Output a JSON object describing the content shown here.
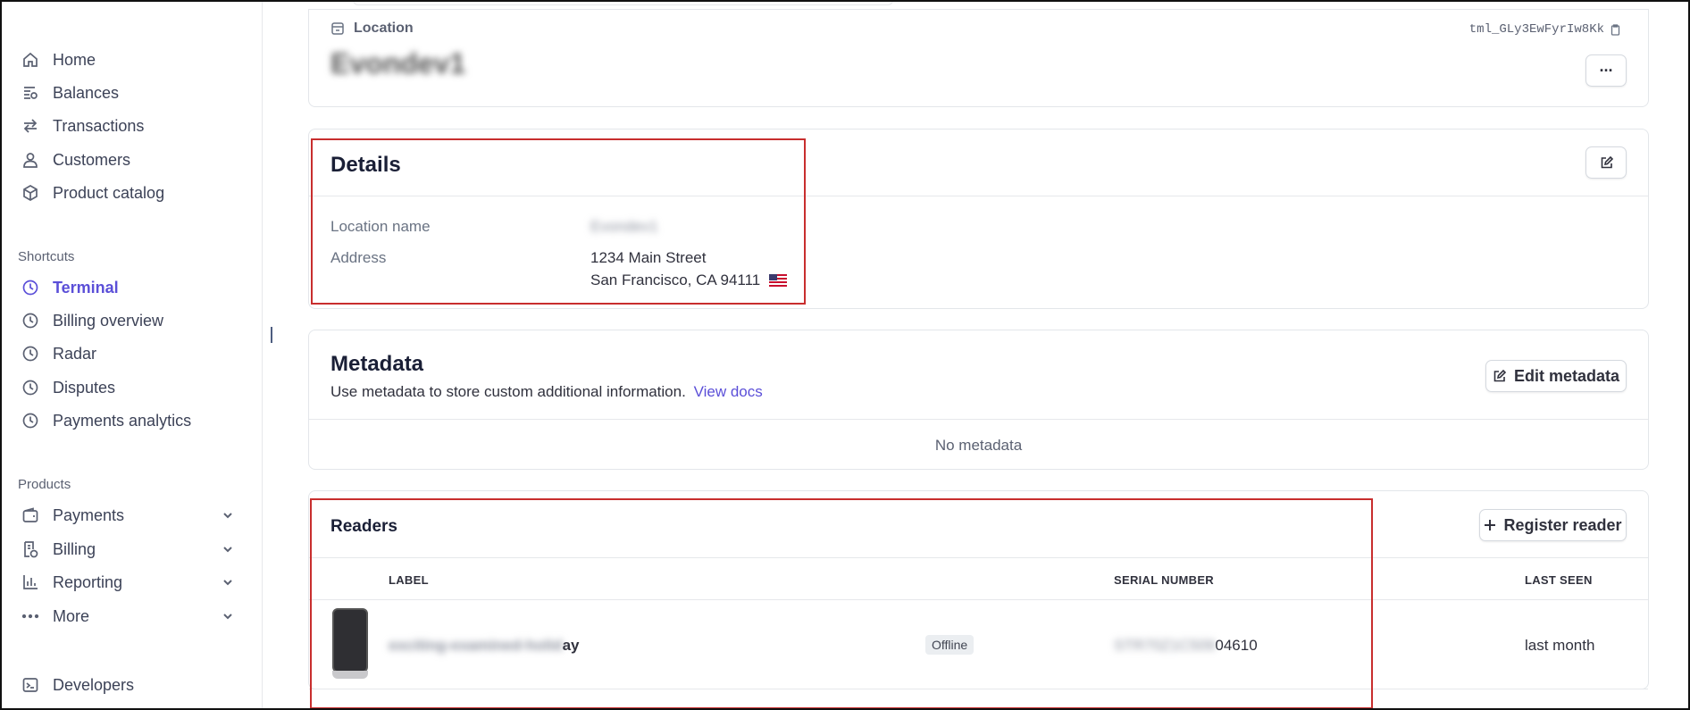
{
  "sidebar": {
    "main_items": [
      {
        "label": "Home",
        "icon": "home-icon"
      },
      {
        "label": "Balances",
        "icon": "balances-icon"
      },
      {
        "label": "Transactions",
        "icon": "arrows-swap-icon"
      },
      {
        "label": "Customers",
        "icon": "person-icon"
      },
      {
        "label": "Product catalog",
        "icon": "box-icon"
      }
    ],
    "shortcuts_label": "Shortcuts",
    "shortcuts": [
      {
        "label": "Terminal",
        "active": true
      },
      {
        "label": "Billing overview"
      },
      {
        "label": "Radar"
      },
      {
        "label": "Disputes"
      },
      {
        "label": "Payments analytics"
      }
    ],
    "products_label": "Products",
    "products": [
      {
        "label": "Payments"
      },
      {
        "label": "Billing"
      },
      {
        "label": "Reporting"
      },
      {
        "label": "More"
      }
    ],
    "developers": "Developers",
    "accent_color": "#5b4fd8"
  },
  "location": {
    "section_label": "Location",
    "name": "Evondev1",
    "id": "tml_GLy3EwFyrIw8Kk",
    "more_button": "···"
  },
  "details": {
    "title": "Details",
    "fields": [
      {
        "label": "Location name",
        "value": "Evondev1"
      },
      {
        "label": "Address",
        "line1": "1234 Main Street",
        "line2": "San Francisco, CA 94111"
      }
    ]
  },
  "metadata": {
    "title": "Metadata",
    "description": "Use metadata to store custom additional information.",
    "link": "View docs",
    "edit_button": "Edit metadata",
    "empty": "No metadata"
  },
  "readers": {
    "title": "Readers",
    "register_button": "Register reader",
    "columns": [
      "LABEL",
      "SERIAL NUMBER",
      "LAST SEEN"
    ],
    "rows": [
      {
        "label_blurred": "exciting-examined-holid",
        "label_visible": "ay",
        "status": "Offline",
        "serial_blurred": "STR70Z1C509",
        "serial_visible": "04610",
        "last_seen": "last month"
      }
    ]
  },
  "highlight_color": "#c82e2e"
}
